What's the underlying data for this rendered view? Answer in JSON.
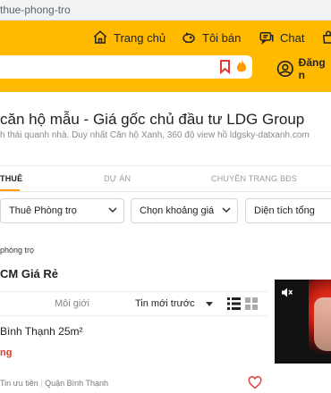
{
  "browser": {
    "url": "thue-phong-tro"
  },
  "header": {
    "nav": [
      {
        "label": "Trang chủ",
        "icon": "home-icon"
      },
      {
        "label": "Tôi bán",
        "icon": "piggy-bank-icon"
      },
      {
        "label": "Chat",
        "icon": "chat-icon"
      }
    ],
    "account_label": "Đăng n",
    "bookmark_icon": "bookmark-icon",
    "accent": "#ffba00"
  },
  "banner": {
    "title": "căn hộ mẫu - Giá gốc chủ đầu tư LDG Group",
    "subtitle": "h thái quanh nhà. Duy nhất Căn hộ Xanh, 360 độ view hồ ldgsky-datxanh.com"
  },
  "tabs": [
    {
      "label": "THUÊ",
      "active": true
    },
    {
      "label": "DỰ ÁN",
      "active": false
    },
    {
      "label": "CHUYÊN TRANG BĐS",
      "active": false
    }
  ],
  "filters": [
    {
      "label": "Thuê Phòng trọ"
    },
    {
      "label": "Chọn khoảng giá"
    },
    {
      "label": "Diện tích tổng"
    }
  ],
  "breadcrumb": "phòng trọ",
  "list": {
    "title": "CM Giá Rẻ",
    "tab_broker": "Môi giới",
    "sort_label": "Tin mới trước",
    "view_modes": [
      "list-view-icon",
      "grid-view-icon"
    ]
  },
  "item": {
    "title": "Bình Thạnh 25m²",
    "price": "ng",
    "priority": "Tin ưu tiên",
    "district": "Quận Bình Thạnh"
  },
  "ad": {
    "mute_icon": "mute-icon"
  }
}
